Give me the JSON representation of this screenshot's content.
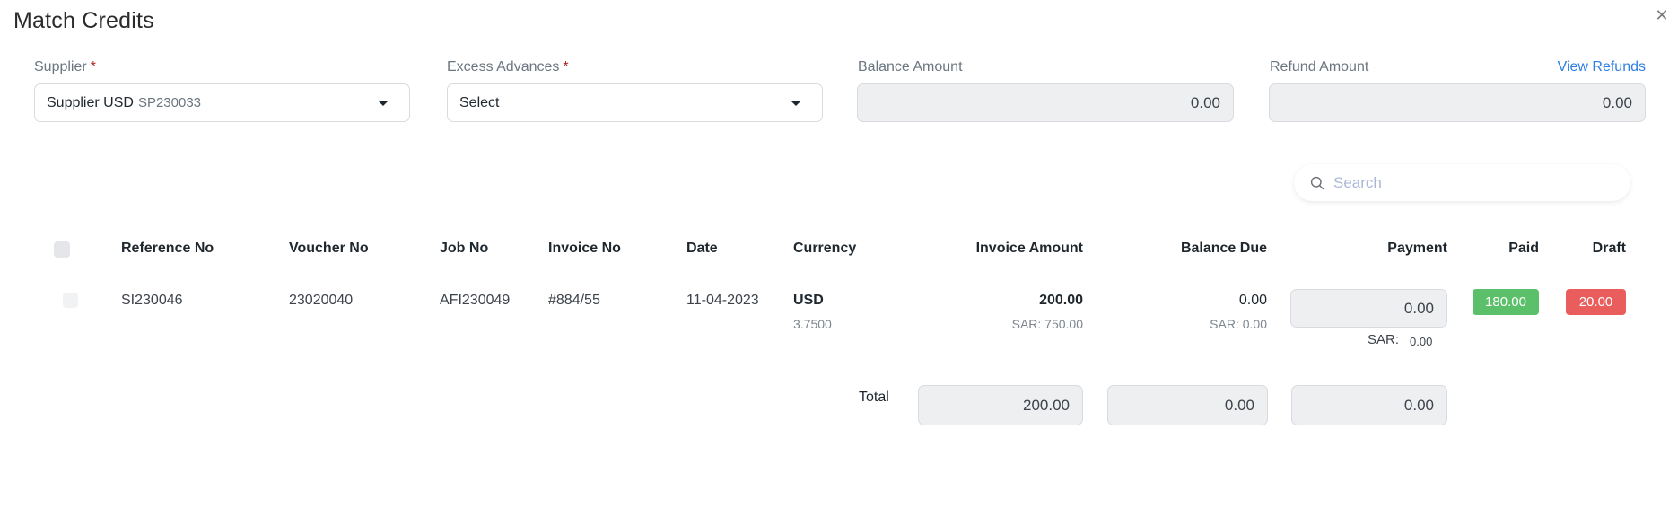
{
  "dialog": {
    "title": "Match Credits",
    "close_icon": "close-icon"
  },
  "fields": {
    "supplier": {
      "label": "Supplier",
      "required_mark": "*",
      "value": "Supplier USD",
      "value_code": "SP230033"
    },
    "excess_advances": {
      "label": "Excess Advances",
      "required_mark": "*",
      "value": "Select"
    },
    "balance_amount": {
      "label": "Balance Amount",
      "value": "0.00"
    },
    "refund_amount": {
      "label": "Refund Amount",
      "value": "0.00",
      "link": "View Refunds"
    }
  },
  "search": {
    "placeholder": "Search",
    "value": "",
    "icon": "search-icon"
  },
  "table": {
    "columns": [
      "Reference No",
      "Voucher No",
      "Job No",
      "Invoice No",
      "Date",
      "Currency",
      "Invoice Amount",
      "Balance Due",
      "Payment",
      "Paid",
      "Draft"
    ],
    "rows": [
      {
        "reference_no": "SI230046",
        "voucher_no": "23020040",
        "job_no": "AFI230049",
        "invoice_no": "#884/55",
        "date": "11-04-2023",
        "currency": "USD",
        "exchange_rate": "3.7500",
        "invoice_amount": "200.00",
        "invoice_amount_sar": "SAR: 750.00",
        "balance_due": "0.00",
        "balance_due_sar": "SAR: 0.00",
        "payment": "0.00",
        "payment_sar_label": "SAR:",
        "payment_sar_value": "0.00",
        "paid": "180.00",
        "draft": "20.00"
      }
    ],
    "totals": {
      "label": "Total",
      "invoice_amount": "200.00",
      "balance_due": "0.00",
      "payment": "0.00"
    }
  },
  "colors": {
    "paid_badge": "#5cc06a",
    "draft_badge": "#e95d5c",
    "link": "#2f7fe0",
    "required": "#b22222"
  }
}
